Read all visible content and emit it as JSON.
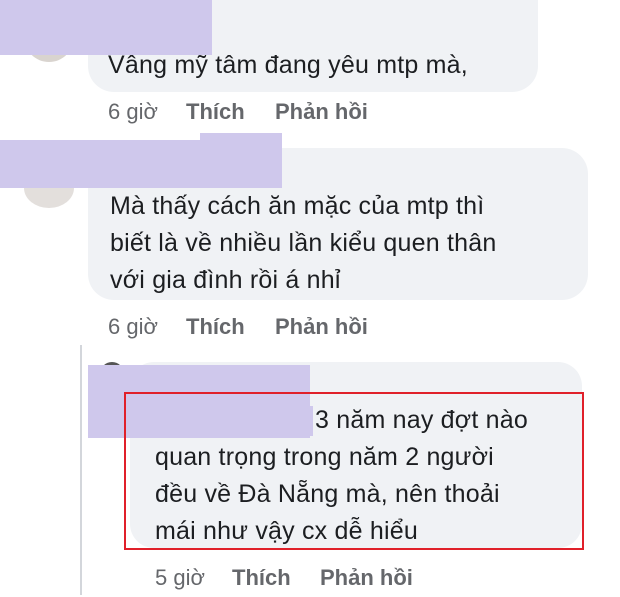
{
  "comments": [
    {
      "text": "Vâng mỹ tâm đang yêu mtp mà,",
      "time": "6 giờ",
      "like": "Thích",
      "reply": "Phản hồi"
    },
    {
      "text": "Mà thấy cách ăn mặc của mtp thì\nbiết là về nhiều lần kiểu quen thân\nvới gia đình rồi á nhỉ",
      "time": "6 giờ",
      "like": "Thích",
      "reply": "Phản hồi"
    },
    {
      "mention": "",
      "text_line1": "3 năm nay đợt nào",
      "text_rest": "quan trọng trong năm 2 người\nđều về Đà Nẵng mà, nên thoải\nmái như vậy cx dễ hiểu",
      "time": "5 giờ",
      "like": "Thích",
      "reply": "Phản hồi"
    }
  ],
  "colors": {
    "bubble": "#f0f2f5",
    "redaction": "#cfc8ec",
    "highlight_box": "#e0202a",
    "meta_text": "#65676b"
  }
}
